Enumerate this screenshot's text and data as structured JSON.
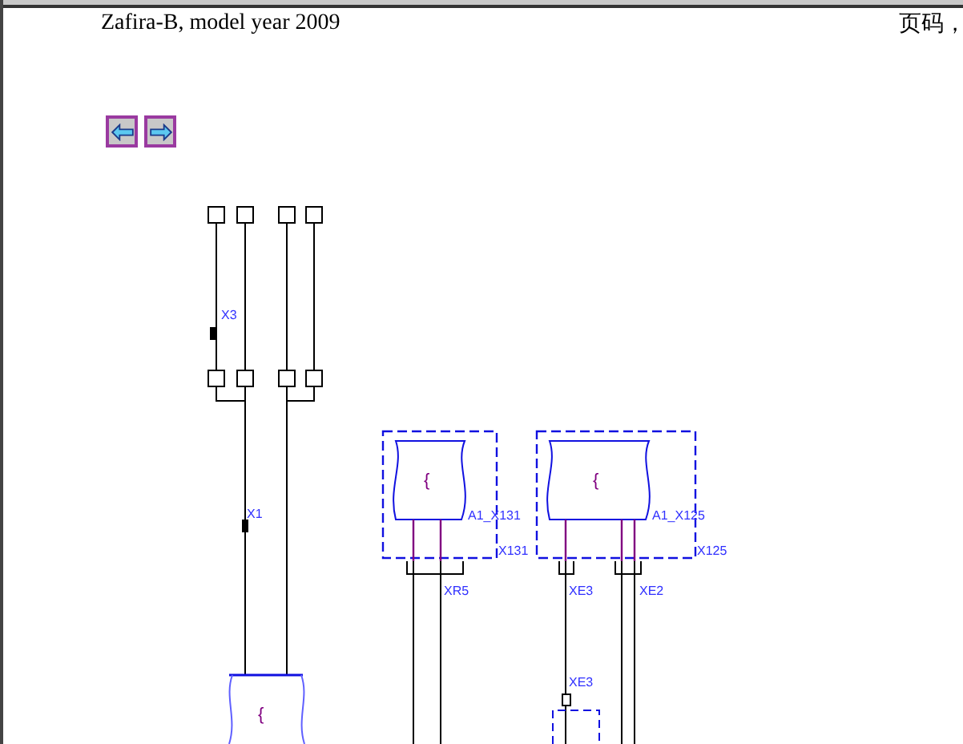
{
  "header": {
    "title": "Zafira-B, model year 2009",
    "page_label": "页码，"
  },
  "nav_buttons": [
    {
      "kind": "back"
    },
    {
      "kind": "forward"
    }
  ],
  "diagram": {
    "connectors": [
      {
        "label": "X3"
      },
      {
        "label": "X1"
      }
    ],
    "modules": [
      {
        "symbol": "{",
        "name": "A1_X131",
        "housing": "X131",
        "plugs": [
          "XR5"
        ]
      },
      {
        "symbol": "{",
        "name": "A1_X125",
        "housing": "X125",
        "plugs": [
          "XE3",
          "XE2"
        ],
        "lower_plug": "XE3"
      }
    ],
    "bottom_module": {
      "symbol": "{"
    }
  }
}
